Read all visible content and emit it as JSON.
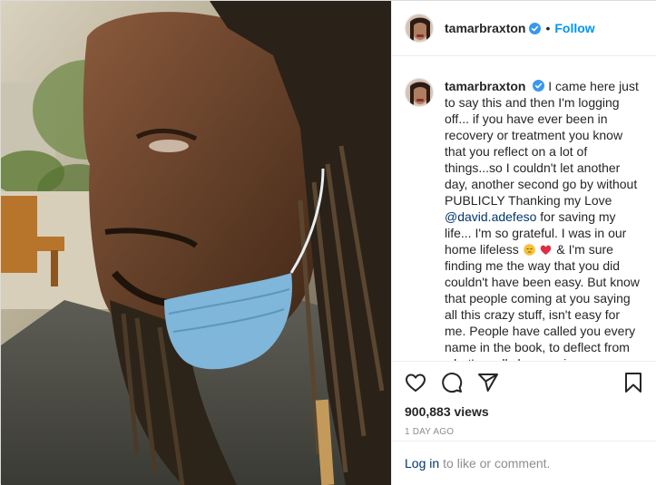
{
  "header": {
    "username": "tamarbraxton",
    "separator": "•",
    "follow_label": "Follow"
  },
  "caption": {
    "username": "tamarbraxton",
    "text_part1": "I came here just to say this and then I'm logging off... if you have ever been in recovery or treatment you know that you reflect on a lot of things...so I couldn't let another day, another second go by without PUBLICLY Thanking my Love",
    "mention": "@david.adefeso",
    "text_part2": "for saving my life... I'm so grateful. I was in our home lifeless",
    "text_part3": "& I'm sure finding me the way that you did couldn't have been easy. But know that people coming at you saying all this crazy stuff, isn't easy for me. People have called you every name in the book, to deflect from what's really been going on. Through this entire time, you have held my hand, heard my cries, held me when I have been"
  },
  "icons": {
    "verified": "verified-badge-icon",
    "like": "heart-icon",
    "comment": "comment-icon",
    "share": "paper-plane-icon",
    "save": "bookmark-icon",
    "emoji1": "pensive-face-emoji",
    "emoji2": "red-heart-emoji"
  },
  "stats": {
    "views": "900,883 views",
    "timestamp": "1 DAY AGO"
  },
  "login": {
    "link_label": "Log in",
    "text": "to like or comment."
  },
  "colors": {
    "accent": "#0095f6",
    "verified": "#3897f0",
    "link_dark": "#00376b",
    "muted": "#8e8e8e"
  }
}
